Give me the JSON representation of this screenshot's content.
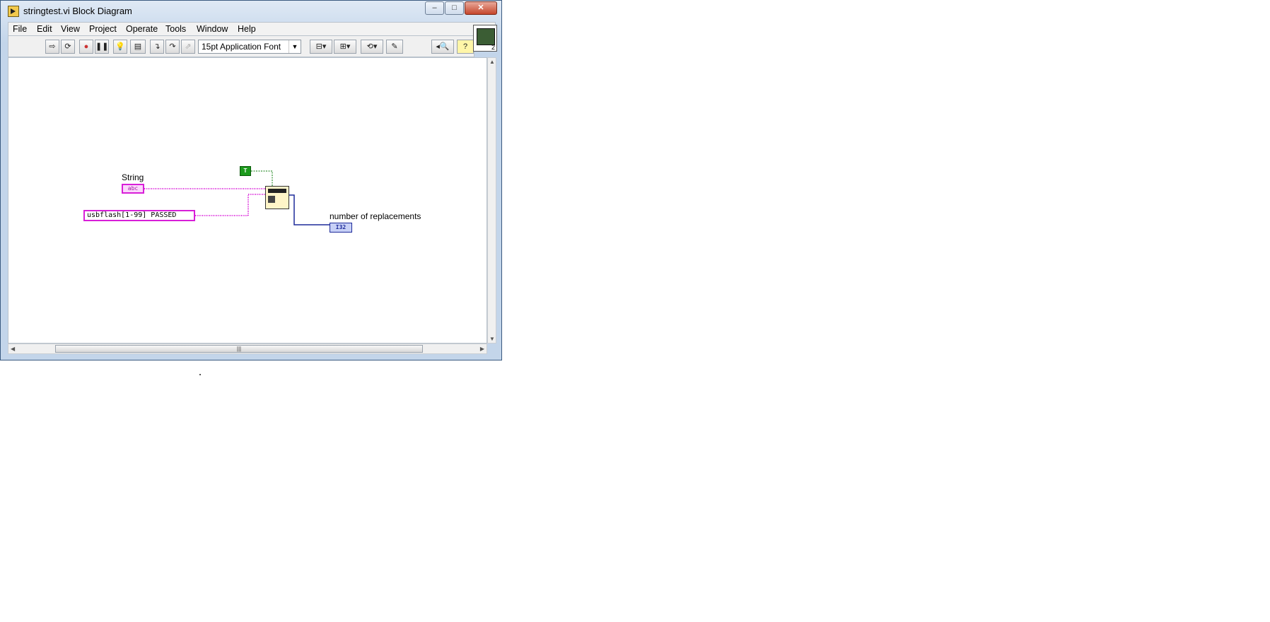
{
  "window": {
    "title": "stringtest.vi Block Diagram",
    "caption_buttons": {
      "minimize": "‒",
      "maximize": "□",
      "close": "✕"
    }
  },
  "menu": {
    "items": [
      "File",
      "Edit",
      "View",
      "Project",
      "Operate",
      "Tools",
      "Window",
      "Help"
    ]
  },
  "toolbar": {
    "font_selector": "15pt Application Font",
    "context_help_count": "2"
  },
  "diagram": {
    "string_control_label": "String",
    "string_control_type": "abc",
    "string_constant_value": "usbflash[1-99] PASSED",
    "boolean_constant_value": "T",
    "indicator_label": "number of replacements",
    "indicator_type": "I32"
  },
  "colors": {
    "string_wire": "#d81fd8",
    "numeric_wire": "#1d2a9a",
    "boolean_wire": "#0a7a0a"
  },
  "icons": {
    "app": "labview-vi-icon",
    "function": "search-and-replace-string-icon",
    "context_help": "context-help-icon"
  }
}
